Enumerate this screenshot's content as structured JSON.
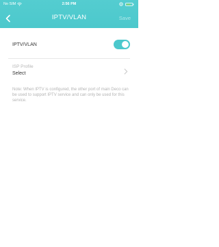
{
  "status_bar": {
    "carrier": "No SIM",
    "time": "2:56 PM",
    "icons": [
      "wifi-icon",
      "location-icon",
      "battery-icon"
    ]
  },
  "nav": {
    "title": "IPTV/VLAN",
    "save_label": "Save",
    "back_icon": "chevron-left-icon"
  },
  "settings": {
    "iptv_label": "IPTV/VLAN",
    "iptv_enabled": true,
    "isp_profile_label": "ISP Profile",
    "isp_profile_value": "Select",
    "note": "Note: When IPTV is configured, the other port of main Deco can be used to support IPTV service and can only be used for this service."
  },
  "colors": {
    "accent": "#4cc8cc",
    "text": "#333333",
    "muted": "#b3b3b3",
    "divider": "#e7e7e7",
    "battery": "#8bd46a"
  }
}
